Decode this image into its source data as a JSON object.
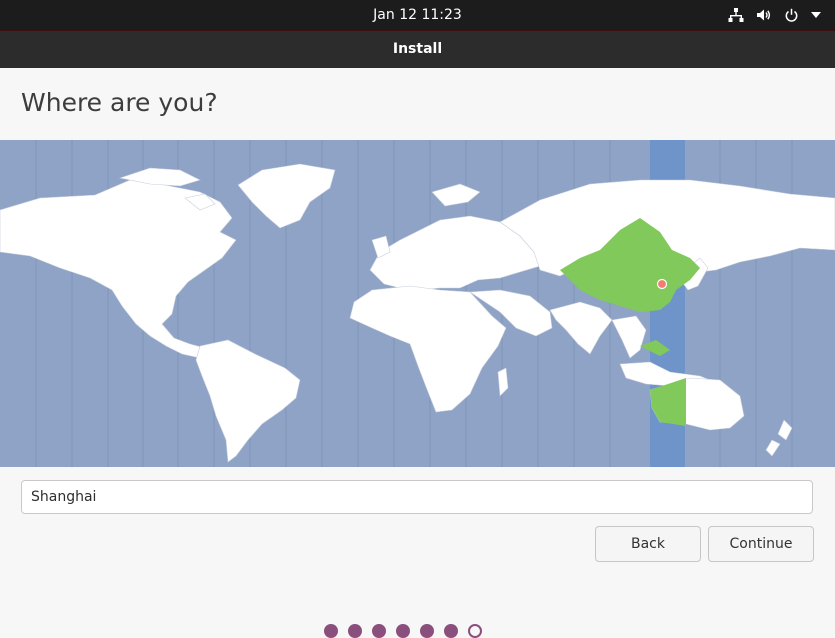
{
  "topbar": {
    "datetime": "Jan 12  11:23",
    "icons": [
      "network-icon",
      "volume-icon",
      "power-icon",
      "chevron-down-icon"
    ]
  },
  "window": {
    "title": "Install"
  },
  "page": {
    "heading": "Where are you?"
  },
  "map": {
    "highlighted_timezone": "Asia/Shanghai",
    "colors": {
      "ocean": "#8fa3c6",
      "land": "#ffffff",
      "selected_region": "#82c95b",
      "selected_band": "#6e94c9",
      "marker": "#f07c72"
    }
  },
  "location": {
    "value": "Shanghai"
  },
  "buttons": {
    "back": "Back",
    "continue": "Continue"
  },
  "progress": {
    "total_steps": 7,
    "completed_steps": 6
  },
  "colors": {
    "accent": "#8a4f7d"
  }
}
